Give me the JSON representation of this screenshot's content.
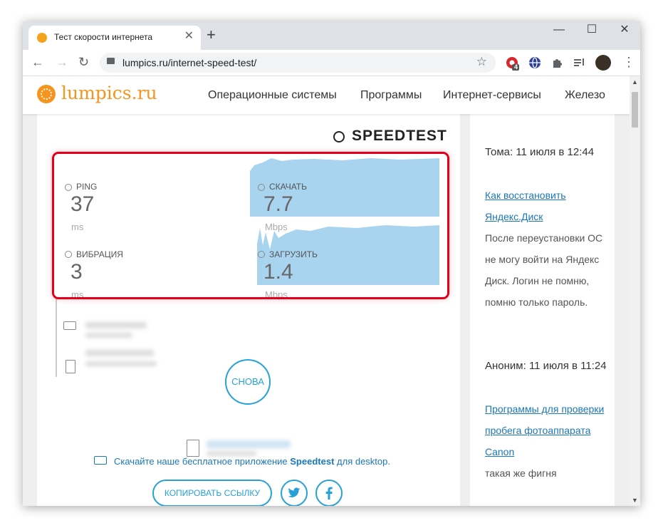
{
  "browser": {
    "tab_title": "Тест скорости интернета",
    "tab_close": "✕",
    "new_tab": "+",
    "window_minimize": "—",
    "window_maximize": "☐",
    "window_close": "✕",
    "url": "lumpics.ru/internet-speed-test/",
    "ext_badge": "4"
  },
  "site": {
    "logo": "lumpics.ru",
    "menu": [
      "Операционные системы",
      "Программы",
      "Интернет-сервисы",
      "Железо"
    ]
  },
  "speedtest": {
    "brand": "SPEEDTEST",
    "ping_label": "PING",
    "ping_value": "37",
    "ping_unit": "ms",
    "jitter_label": "ВИБРАЦИЯ",
    "jitter_value": "3",
    "jitter_unit": "ms",
    "download_label": "СКАЧАТЬ",
    "download_value": "7.7",
    "download_unit": "Mbps",
    "upload_label": "ЗАГРУЗИТЬ",
    "upload_value": "1.4",
    "upload_unit": "Mbps",
    "again_label": "СНОВА",
    "download_app_prefix": "Скачайте наше бесплатное приложение ",
    "download_app_brand": "Speedtest",
    "download_app_suffix": " для desktop.",
    "copy_link_label": "КОПИРОВАТЬ ССЫЛКУ",
    "chart_color": "#a9d4ef"
  },
  "comments": [
    {
      "author": "Тома: 11 июля в 12:44",
      "link": "Как восстановить Яндекс.Диск",
      "text": "После переустановки ОС не могу войти на Яндекс Диск. Логин не помню, помню только пароль."
    },
    {
      "author": "Аноним: 11 июля в 11:24",
      "link": "Программы для проверки пробега фотоаппарата Canon",
      "text": "такая же фигня"
    }
  ]
}
